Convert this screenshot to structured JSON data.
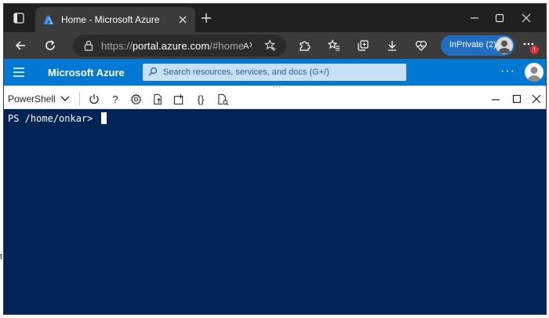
{
  "browser": {
    "tab_title": "Home - Microsoft Azure",
    "address": {
      "scheme": "https://",
      "host": "portal.azure.com",
      "path": "/#home"
    },
    "inprivate_label": "InPrivate (2)",
    "notification_badge": "!"
  },
  "azure": {
    "title": "Microsoft Azure",
    "search_placeholder": "Search resources, services, and docs (G+/)",
    "more_label": "···",
    "grip_label": "···",
    "accent_color": "#0078d4"
  },
  "shell": {
    "type_label": "PowerShell",
    "help_label": "?",
    "braces_label": "{}",
    "prompt": "PS /home/onkar>",
    "terminal_bg": "#012456"
  },
  "stray_glyph": "t",
  "icons": [
    "tab-actions-icon",
    "azure-logo-icon",
    "close-icon",
    "plus-icon",
    "minimize-icon",
    "maximize-icon",
    "back-arrow-icon",
    "refresh-icon",
    "lock-icon",
    "read-aloud-icon",
    "add-favorite-icon",
    "extensions-icon",
    "favorites-icon",
    "collections-icon",
    "downloads-icon",
    "browser-essentials-icon",
    "settings-more-icon",
    "hamburger-icon",
    "search-icon",
    "power-icon",
    "help-icon",
    "gear-icon",
    "upload-download-icon",
    "open-new-session-icon",
    "editor-icon",
    "web-preview-icon"
  ]
}
